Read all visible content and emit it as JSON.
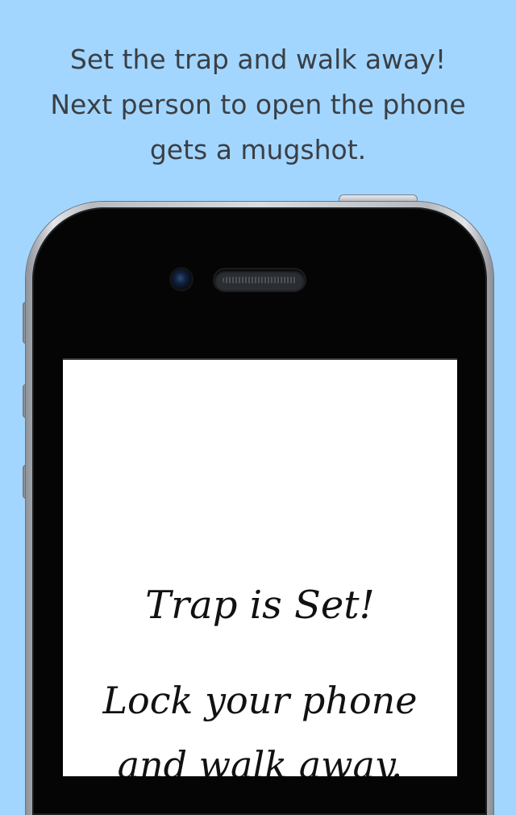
{
  "headline": {
    "line1": "Set the trap and walk away!",
    "line2": "Next person to open the phone",
    "line3": "gets a mugshot."
  },
  "screen": {
    "title": "Trap is Set!",
    "body_line1": "Lock your phone",
    "body_line2": "and walk away."
  },
  "colors": {
    "background": "#a3d6ff",
    "headline_text": "#3a3f45",
    "screen_background": "#ffffff",
    "screen_text": "#111111"
  }
}
